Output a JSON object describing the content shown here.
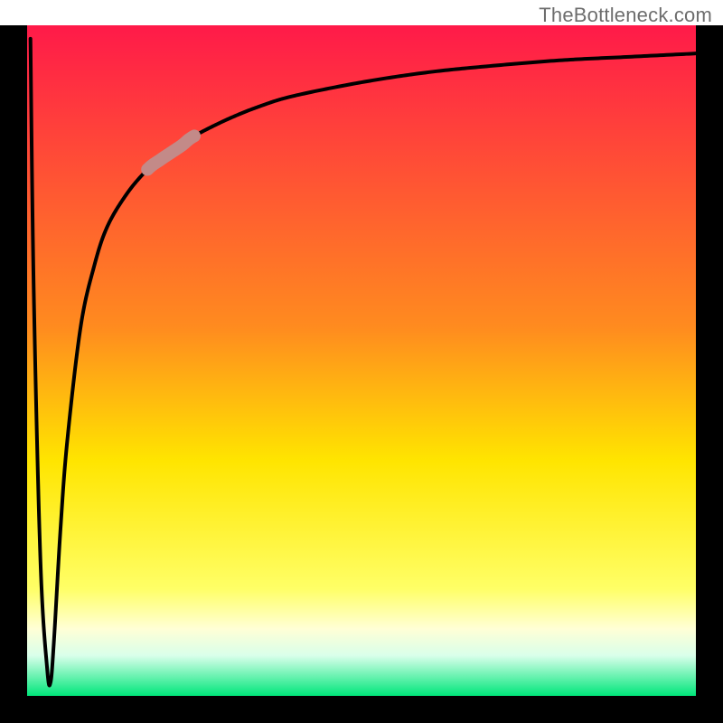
{
  "watermark": {
    "text": "TheBottleneck.com"
  },
  "colors": {
    "frame": "#000000",
    "curve": "#000000",
    "highlight": "#c38a88",
    "gradient_stops": [
      {
        "offset": 0.0,
        "color": "#ff1a49"
      },
      {
        "offset": 0.45,
        "color": "#ff8b1f"
      },
      {
        "offset": 0.65,
        "color": "#ffe500"
      },
      {
        "offset": 0.84,
        "color": "#ffff66"
      },
      {
        "offset": 0.9,
        "color": "#ffffd6"
      },
      {
        "offset": 0.94,
        "color": "#d9ffea"
      },
      {
        "offset": 1.0,
        "color": "#00e67a"
      }
    ]
  },
  "chart_data": {
    "type": "line",
    "title": "",
    "xlabel": "",
    "ylabel": "",
    "xlim": [
      0,
      100
    ],
    "ylim": [
      0,
      100
    ],
    "x": [
      0.5,
      1,
      2,
      3,
      3.5,
      4,
      5,
      6,
      8,
      10,
      12,
      15,
      18,
      20,
      23,
      25,
      30,
      35,
      40,
      50,
      60,
      70,
      80,
      90,
      100
    ],
    "values": [
      98,
      60,
      20,
      4,
      2,
      8,
      25,
      38,
      55,
      64,
      70,
      75,
      78.5,
      80,
      82,
      83.5,
      86,
      88,
      89.5,
      91.5,
      93,
      94,
      94.8,
      95.3,
      95.8
    ],
    "highlight_segment": {
      "x_start": 18,
      "x_end": 25
    },
    "annotations": []
  }
}
